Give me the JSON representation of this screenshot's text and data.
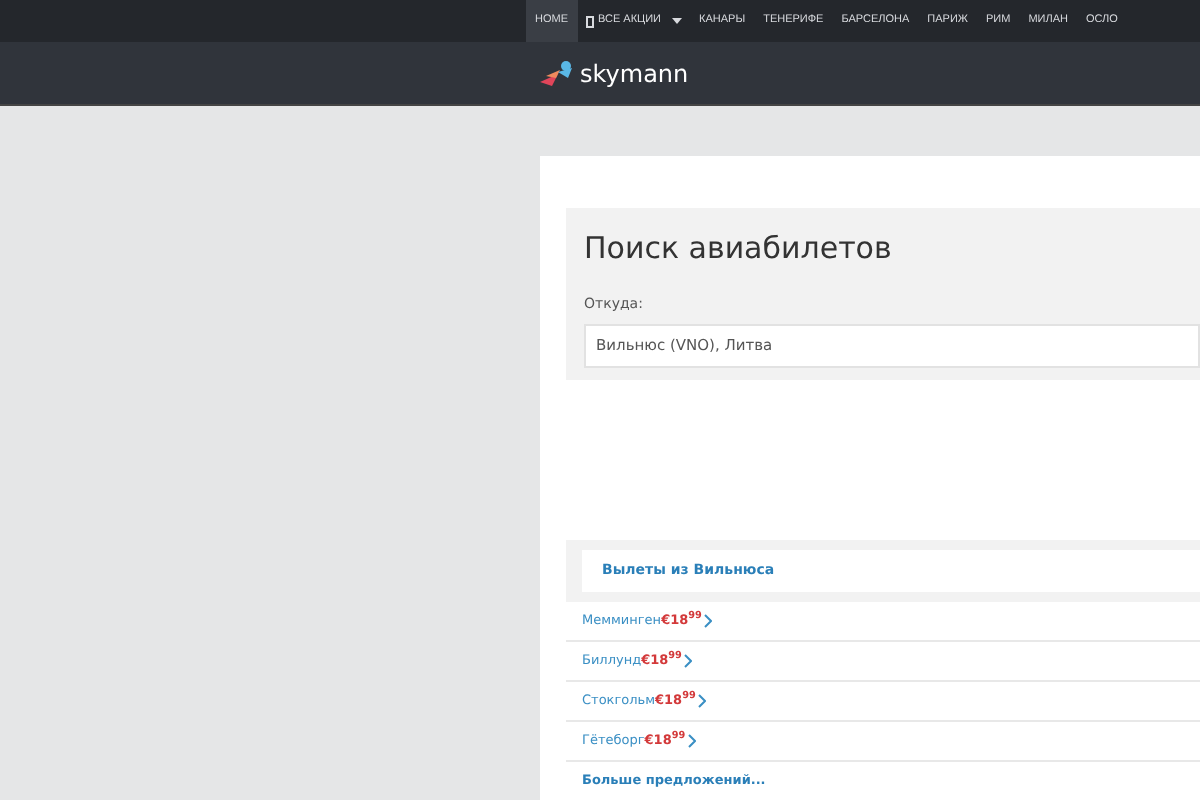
{
  "nav": {
    "items": [
      {
        "label": "HOME",
        "selected": true,
        "kind": "link"
      },
      {
        "label": "ВСЕ АКЦИИ",
        "selected": false,
        "kind": "dropdown"
      },
      {
        "label": "КАНАРЫ",
        "selected": false,
        "kind": "link"
      },
      {
        "label": "ТЕНЕРИФЕ",
        "selected": false,
        "kind": "link"
      },
      {
        "label": "БАРСЕЛОНА",
        "selected": false,
        "kind": "link"
      },
      {
        "label": "ПАРИЖ",
        "selected": false,
        "kind": "link"
      },
      {
        "label": "РИМ",
        "selected": false,
        "kind": "link"
      },
      {
        "label": "МИЛАН",
        "selected": false,
        "kind": "link"
      },
      {
        "label": "ОСЛО",
        "selected": false,
        "kind": "link"
      }
    ]
  },
  "header": {
    "logo_text": "skymann"
  },
  "search": {
    "title": "Поиск авиабилетов",
    "from_label": "Откуда:",
    "from_value": "Вильнюс (VNO), Литва"
  },
  "deals": {
    "title": "Вылеты из Вильнюса",
    "items": [
      {
        "city": "Мемминген",
        "price": "€18$^{99}$"
      },
      {
        "city": "Биллунд",
        "price": "€18$^{99}$"
      },
      {
        "city": "Стокгольм",
        "price": "€18$^{99}$"
      },
      {
        "city": "Гётеборг",
        "price": "€18$^{99}$"
      }
    ],
    "more": "Больше предложений..."
  }
}
